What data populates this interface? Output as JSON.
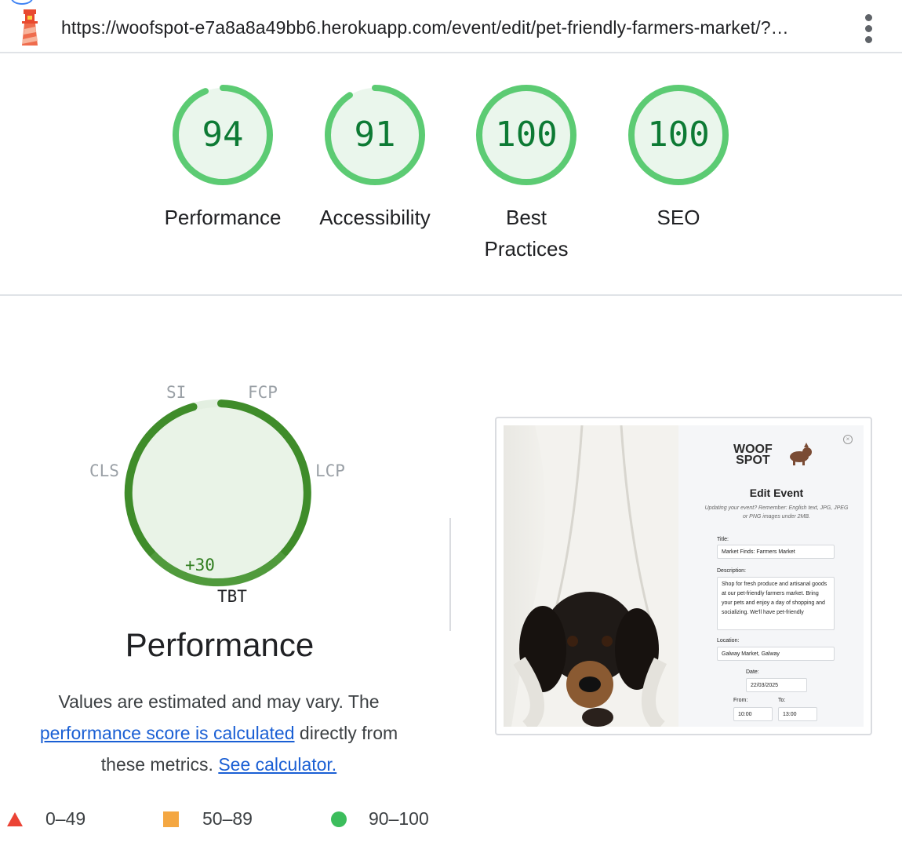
{
  "browser": {
    "url": "https://woofspot-e7a8a8a49bb6.herokuapp.com/event/edit/pet-friendly-farmers-market/?…"
  },
  "scores": [
    {
      "value": "94",
      "label": "Performance",
      "fraction": 0.94
    },
    {
      "value": "91",
      "label": "Accessibility",
      "fraction": 0.91
    },
    {
      "value": "100",
      "label": "Best Practices",
      "fraction": 1.0
    },
    {
      "value": "100",
      "label": "SEO",
      "fraction": 1.0
    }
  ],
  "perf_gauge": {
    "metrics": {
      "si": "SI",
      "fcp": "FCP",
      "lcp": "LCP",
      "cls": "CLS",
      "tbt": "TBT"
    },
    "tbt_delta": "+30",
    "title": "Performance",
    "desc_prefix": "Values are estimated and may vary. The",
    "desc_link1": "performance score is calculated",
    "desc_mid": "directly from these metrics.",
    "desc_link2": "See calculator."
  },
  "legend": [
    {
      "range": "0–49",
      "color": "#eb4335",
      "shape": "triangle"
    },
    {
      "range": "50–89",
      "color": "#f4a742",
      "shape": "square"
    },
    {
      "range": "90–100",
      "color": "#3cbd5c",
      "shape": "circle"
    }
  ],
  "screenshot": {
    "logo_line1": "WOOF",
    "logo_line2": "SPOT",
    "heading": "Edit Event",
    "note": "Updating your event? Remember: English text, JPG, JPEG or PNG images under 2MB.",
    "title_label": "Title:",
    "title_value": "Market Finds: Farmers Market",
    "description_label": "Description:",
    "description_value": "Shop for fresh produce and artisanal goods at our pet-friendly farmers market. Bring your pets and enjoy a day of shopping and socializing. We'll have pet-friendly",
    "location_label": "Location:",
    "location_value": "Galway Market, Galway",
    "date_label": "Date:",
    "date_value": "22/03/2025",
    "from_label": "From:",
    "from_value": "10:00",
    "to_label": "To:",
    "to_value": "13:00"
  },
  "colors": {
    "pass_green": "#0d7a34",
    "gauge_ring": "#5ccb73",
    "gauge_fill": "#eaf6ec",
    "perf_ring": "#3f8c2a"
  }
}
